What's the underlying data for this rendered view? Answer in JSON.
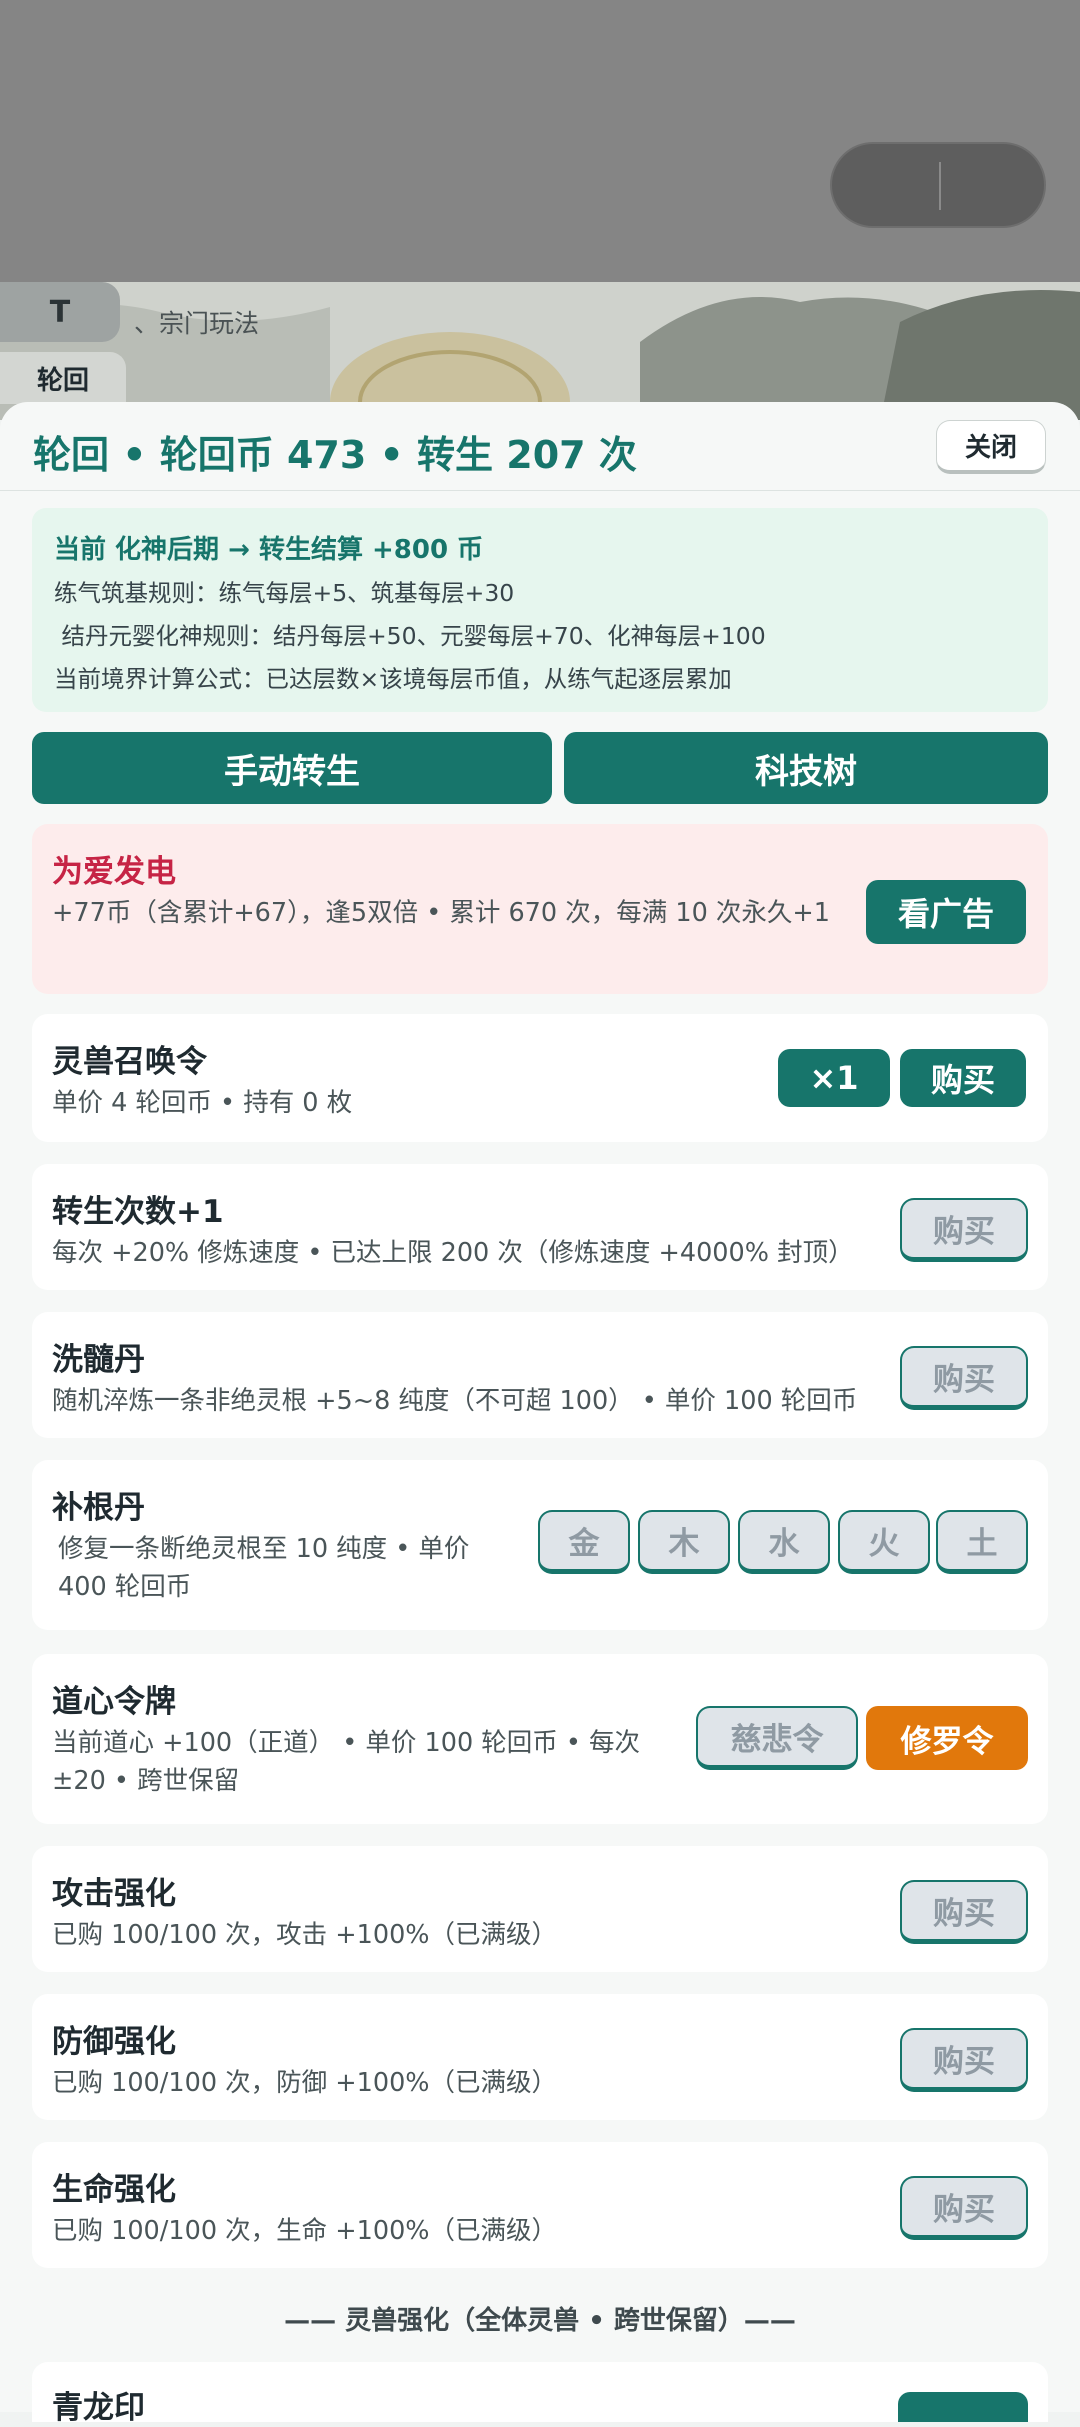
{
  "mini_program": {
    "more_icon": "more-dots-icon",
    "close_icon": "target-circle-icon"
  },
  "background": {
    "tag_t": "T",
    "section_text": "、宗门玩法",
    "tab_lunhui": "轮回"
  },
  "header": {
    "title": "轮回 • 轮回币 473 • 转生 207 次",
    "close_label": "关闭"
  },
  "info": {
    "current": "当前 化神后期 → 转生结算 +800 币",
    "rule1": "练气筑基规则：练气每层+5、筑基每层+30",
    "rule2": " 结丹元婴化神规则：结丹每层+50、元婴每层+70、化神每层+100",
    "formula": "当前境界计算公式：已达层数×该境每层币值，从练气起逐层累加"
  },
  "actions": {
    "manual_rebirth": "手动转生",
    "tech_tree": "科技树"
  },
  "power": {
    "name": "为爱发电",
    "desc": "+77币（含累计+67），逢5双倍 • 累计 670 次，每满 10 次永久+1",
    "button": "看广告"
  },
  "items": {
    "summon": {
      "name": "灵兽召唤令",
      "desc": "单价 4 轮回币 • 持有 0 枚",
      "qty": "×1",
      "buy": "购买"
    },
    "rebirth_count": {
      "name": "转生次数+1",
      "desc": "每次 +20% 修炼速度 • 已达上限 200 次（修炼速度 +4000% 封顶）",
      "buy": "购买"
    },
    "marrow": {
      "name": "洗髓丹",
      "desc": "随机淬炼一条非绝灵根 +5~8 纯度（不可超 100） • 单价 100 轮回币",
      "buy": "购买"
    },
    "root": {
      "name": "补根丹",
      "desc": "修复一条断绝灵根至 10 纯度 • 单价 400 轮回币",
      "elements": [
        "金",
        "木",
        "水",
        "火",
        "土"
      ]
    },
    "daoxin": {
      "name": "道心令牌",
      "desc": "当前道心 +100（正道） • 单价 100 轮回币 • 每次 ±20 • 跨世保留",
      "mercy": "慈悲令",
      "asura": "修罗令"
    },
    "attack": {
      "name": "攻击强化",
      "desc": "已购 100/100 次，攻击 +100%（已满级）",
      "buy": "购买"
    },
    "defense": {
      "name": "防御强化",
      "desc": "已购 100/100 次，防御 +100%（已满级）",
      "buy": "购买"
    },
    "hp": {
      "name": "生命强化",
      "desc": "已购 100/100 次，生命 +100%（已满级）",
      "buy": "购买"
    }
  },
  "section": {
    "beast_title": "—— 灵兽强化（全体灵兽 • 跨世保留）——",
    "next_item": "青龙印"
  },
  "colors": {
    "accent": "#17756b",
    "danger": "#c62445",
    "orange": "#e1780c"
  }
}
